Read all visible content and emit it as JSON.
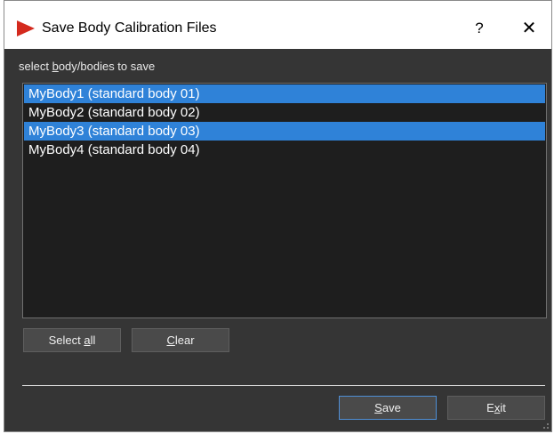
{
  "window": {
    "title": "Save Body Calibration Files",
    "help_label": "?",
    "close_label": "✕",
    "accent_color": "#2f82d8",
    "icon": "app-logo-icon"
  },
  "list": {
    "label_prefix": "select ",
    "label_mnemonic": "b",
    "label_rest": "ody/bodies to save",
    "items": [
      {
        "label": "MyBody1 (standard body 01)",
        "selected": true
      },
      {
        "label": "MyBody2 (standard body 02)",
        "selected": false
      },
      {
        "label": "MyBody3 (standard body 03)",
        "selected": true
      },
      {
        "label": "MyBody4 (standard body 04)",
        "selected": false
      }
    ]
  },
  "buttons": {
    "select_all": {
      "prefix": "Select ",
      "mnemonic": "a",
      "rest": "ll"
    },
    "clear": {
      "prefix": "",
      "mnemonic": "C",
      "rest": "lear"
    },
    "save": {
      "prefix": "",
      "mnemonic": "S",
      "rest": "ave"
    },
    "exit": {
      "prefix": "E",
      "mnemonic": "x",
      "rest": "it"
    }
  }
}
